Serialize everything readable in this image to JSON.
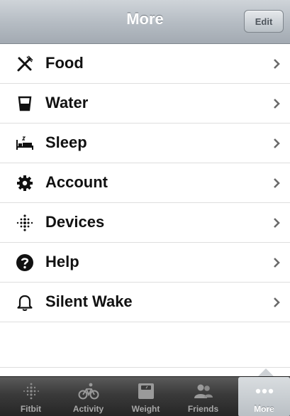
{
  "navbar": {
    "title": "More",
    "edit_label": "Edit"
  },
  "menu": {
    "items": [
      {
        "label": "Food",
        "icon": "fork-knife-icon"
      },
      {
        "label": "Water",
        "icon": "glass-icon"
      },
      {
        "label": "Sleep",
        "icon": "bed-icon"
      },
      {
        "label": "Account",
        "icon": "gear-icon"
      },
      {
        "label": "Devices",
        "icon": "fitbit-dots-icon"
      },
      {
        "label": "Help",
        "icon": "question-icon"
      },
      {
        "label": "Silent Wake",
        "icon": "bell-icon"
      }
    ],
    "chevron": "chevron-right-icon"
  },
  "tabbar": {
    "tabs": [
      {
        "label": "Fitbit",
        "icon": "fitbit-dots-icon"
      },
      {
        "label": "Activity",
        "icon": "bicycle-icon"
      },
      {
        "label": "Weight",
        "icon": "scale-icon"
      },
      {
        "label": "Friends",
        "icon": "people-icon"
      },
      {
        "label": "More",
        "icon": "ellipsis-icon",
        "active": true
      }
    ]
  },
  "colors": {
    "navbar": "#b4bbc2",
    "tabbar": "#3a3a3a",
    "active_tab": "#c9ced2"
  }
}
